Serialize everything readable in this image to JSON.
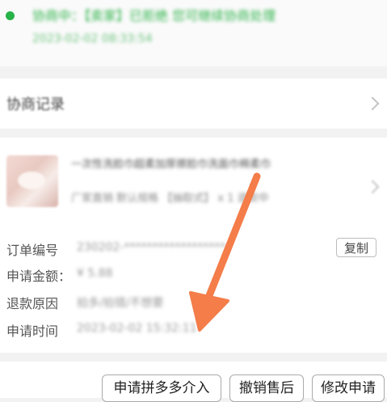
{
  "status": {
    "text": "协商中：【卖家】已拒绝 您可继续协商处理",
    "time": "2023-02-02 08:33:54"
  },
  "record": {
    "label": "协商记录"
  },
  "product": {
    "title": "一次性洗脸巾超柔加厚擦脸巾洗面巾棉柔巾",
    "sku": "厂家直销 默认规格 【抽取式】 x 1 退款中"
  },
  "order": {
    "order_no_label": "订单编号",
    "order_no_value": "230202-******************",
    "copy_label": "复制",
    "amount_label": "申请金额：",
    "amount_value": "¥ 5.88",
    "reason_label": "退款原因",
    "reason_value": "拍多/拍错/不想要",
    "time_label": "申请时间",
    "time_value": "2023-02-02 15:32:11"
  },
  "actions": {
    "platform_intervene": "申请拼多多介入",
    "cancel_aftersale": "撤销售后",
    "modify_request": "修改申请"
  },
  "colors": {
    "status_green": "#2fb34b",
    "arrow_orange": "#f47d4a"
  }
}
